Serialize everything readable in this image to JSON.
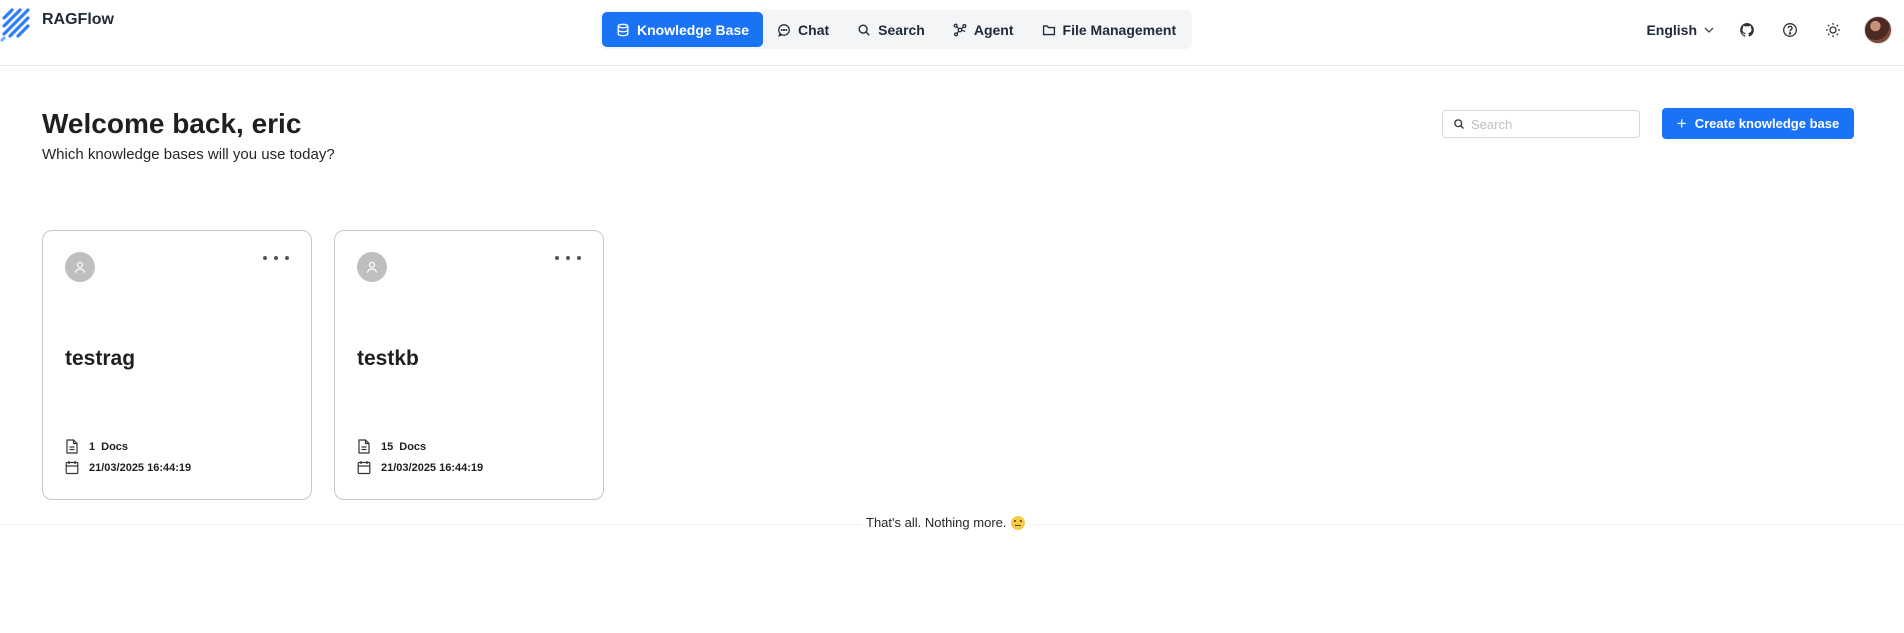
{
  "header": {
    "brand_name": "RAGFlow",
    "nav": [
      {
        "label": "Knowledge Base",
        "icon": "database-icon",
        "active": true
      },
      {
        "label": "Chat",
        "icon": "chat-bubble-icon",
        "active": false
      },
      {
        "label": "Search",
        "icon": "search-icon",
        "active": false
      },
      {
        "label": "Agent",
        "icon": "agent-graph-icon",
        "active": false
      },
      {
        "label": "File Management",
        "icon": "folder-icon",
        "active": false
      }
    ],
    "language": "English",
    "right_icons": [
      "github-icon",
      "help-circle-icon",
      "sun-icon",
      "user-avatar"
    ]
  },
  "welcome": {
    "title": "Welcome back, eric",
    "subtitle": "Which knowledge bases will you use today?"
  },
  "search": {
    "placeholder": "Search",
    "value": ""
  },
  "create_button": {
    "label": "Create knowledge base"
  },
  "knowledge_bases": [
    {
      "name": "testrag",
      "docs_count": "1",
      "docs_label": "Docs",
      "date": "21/03/2025 16:44:19"
    },
    {
      "name": "testkb",
      "docs_count": "15",
      "docs_label": "Docs",
      "date": "21/03/2025 16:44:19"
    }
  ],
  "end_note": "That's all. Nothing more.",
  "colors": {
    "accent": "#1a73f5",
    "card_border": "#c7c7c7",
    "avatar_placeholder": "#bfbfbf"
  }
}
